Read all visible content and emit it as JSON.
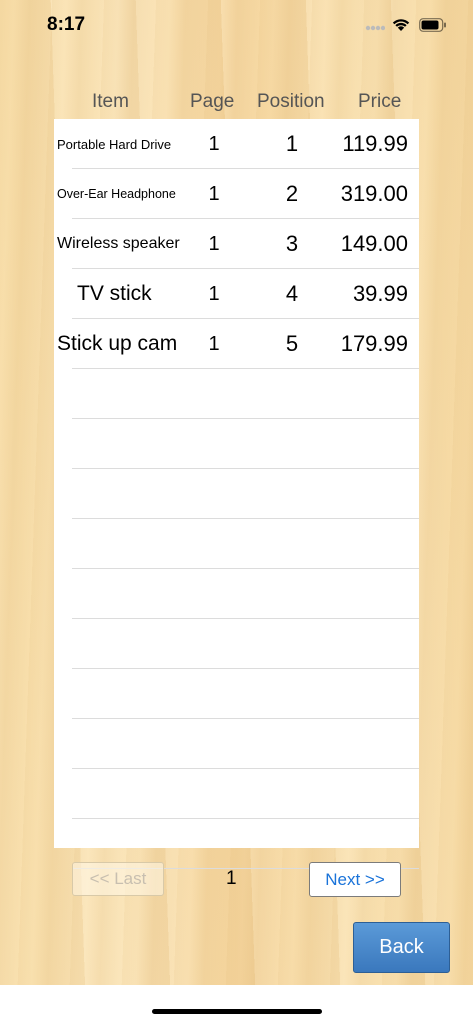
{
  "status_bar": {
    "time": "8:17"
  },
  "table": {
    "headers": {
      "item": "Item",
      "page": "Page",
      "position": "Position",
      "price": "Price"
    },
    "rows": [
      {
        "item": "Portable Hard Drive",
        "page": "1",
        "position": "1",
        "price": "119.99"
      },
      {
        "item": "Over-Ear Headphone",
        "page": "1",
        "position": "2",
        "price": "319.00"
      },
      {
        "item": "Wireless speaker",
        "page": "1",
        "position": "3",
        "price": "149.00"
      },
      {
        "item": "TV stick",
        "page": "1",
        "position": "4",
        "price": "39.99"
      },
      {
        "item": "Stick up cam",
        "page": "1",
        "position": "5",
        "price": "179.99"
      }
    ]
  },
  "pagination": {
    "prev_label": "<< Last",
    "current_page": "1",
    "next_label": "Next >>"
  },
  "back_label": "Back",
  "colors": {
    "accent_blue": "#1a73d9",
    "back_button": "#4a88cb"
  }
}
